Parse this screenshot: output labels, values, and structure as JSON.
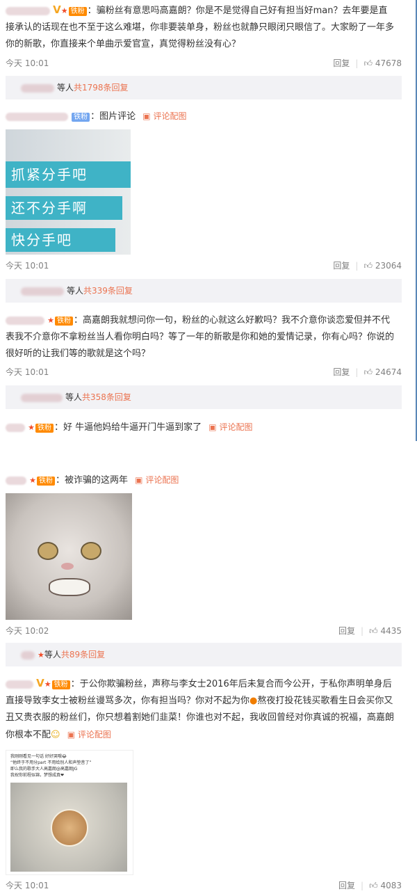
{
  "badge_label": "铁粉",
  "pic_link_label": "评论配图",
  "reply_label": "回复",
  "like_icon": "thumbs-up-icon",
  "time": "今天 10:01",
  "time_b": "今天 10:02",
  "c1": {
    "text_a": "：骗粉丝有意思吗高嘉朗？你是不是觉得自己好有担当好man？去年要是直",
    "text_b": "接承认的话现在也不至于这么难堪，你非要装单身，粉丝也就静只眼闭只眼信了。大家盼了一年多",
    "text_c": "你的新歌，你直接来个单曲示爱官宣，真觉得粉丝没有心？",
    "likes": "47678",
    "replies_prefix": "等人",
    "replies_count": "共1798条回复"
  },
  "c2": {
    "text": "：图片评论",
    "meme_lines": [
      "抓紧分手吧",
      "还不分手啊",
      "快分手吧"
    ],
    "likes": "23064",
    "replies_prefix": "等人",
    "replies_count": "共339条回复"
  },
  "c3": {
    "text_a": "：高嘉朗我就想问你一句，粉丝的心就这么好歉吗？我不介意你谈恋爱但并不代",
    "text_b": "表我不介意你不拿粉丝当人看你明白吗？等了一年的新歌是你和她的爱情记录，你有心吗？你说的",
    "text_c": "很好听的让我们等的歌就是这个吗？",
    "likes": "24674",
    "replies_prefix": "等人",
    "replies_count": "共358条回复"
  },
  "c4": {
    "text": "：好 牛逼他妈给牛逼开门牛逼到家了"
  },
  "c5": {
    "text": "：被诈骗的这两年",
    "likes": "4435",
    "replies_prefix": "等人",
    "replies_count": "共89条回复"
  },
  "c6": {
    "text_a": "：于公你欺骗粉丝，声称与李女士2016年后未复合而今公开，于私你声明单身后",
    "text_b": "直接导致李女士被粉丝谩骂多次，你有担当吗？你对不起为你",
    "text_b2": "熬夜打投花钱买歌看生日会买你又",
    "text_c": "丑又贵衣服的粉丝们，你只想着割她们韭菜！你谁也对不起，我收回曾经对你真诚的祝福，高嘉朗",
    "text_d": "你根本不配",
    "post_lines": [
      "我刚刚看见一句话 好好哭哦😂",
      "“他终于不用分part 不用给别人和声垫音了”",
      "即么我的歌手大人高嘉朗@高嘉朗JG",
      "我祝你前程似锦，梦想成真❤"
    ],
    "likes": "4083"
  }
}
